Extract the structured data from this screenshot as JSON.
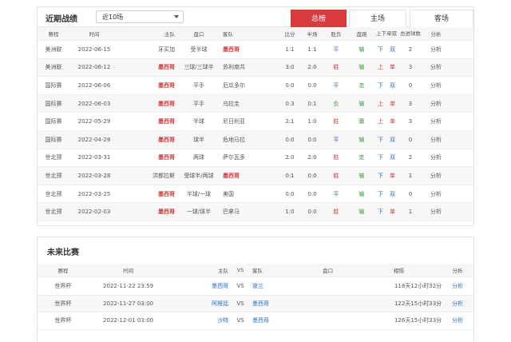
{
  "recent": {
    "title": "近期战绩",
    "select": {
      "value": "近10场"
    },
    "tabs": [
      {
        "label": "总榜",
        "active": true
      },
      {
        "label": "主场",
        "active": false
      },
      {
        "label": "客场",
        "active": false
      }
    ],
    "headers": [
      "赛程",
      "时间",
      "主队",
      "盘口",
      "客队",
      "比分",
      "半场",
      "胜负",
      "盘路",
      "上下单双",
      "总进球数",
      "分析"
    ],
    "rows": [
      {
        "league": "美洲联",
        "date": "2022-06-15",
        "home": "牙买加",
        "handicap": "受半球",
        "away": "墨西哥",
        "score": "1:1",
        "half": "1:1",
        "result": "平",
        "pan": "输",
        "ou": "下",
        "oe": "双",
        "goals": "2",
        "analysis": "分析"
      },
      {
        "league": "美洲联",
        "date": "2022-06-12",
        "home": "墨西哥",
        "handicap": "三球/三球半",
        "away": "苏利南共",
        "score": "3:0",
        "half": "2:0",
        "result": "胜",
        "pan": "输",
        "ou": "上",
        "oe": "单",
        "goals": "3",
        "analysis": "分析"
      },
      {
        "league": "国际赛",
        "date": "2022-06-06",
        "home": "墨西哥",
        "handicap": "平手",
        "away": "厄瓜多尔",
        "score": "0:0",
        "half": "0:0",
        "result": "平",
        "pan": "走",
        "ou": "下",
        "oe": "双",
        "goals": "0",
        "analysis": "分析"
      },
      {
        "league": "国际赛",
        "date": "2022-06-03",
        "home": "墨西哥",
        "handicap": "平手",
        "away": "乌拉圭",
        "score": "0:3",
        "half": "0:1",
        "result": "负",
        "pan": "输",
        "ou": "上",
        "oe": "单",
        "goals": "3",
        "analysis": "分析"
      },
      {
        "league": "国际赛",
        "date": "2022-05-29",
        "home": "墨西哥",
        "handicap": "半球",
        "away": "尼日利亚",
        "score": "2:1",
        "half": "1:0",
        "result": "胜",
        "pan": "赢",
        "ou": "上",
        "oe": "单",
        "goals": "3",
        "analysis": "分析"
      },
      {
        "league": "国际赛",
        "date": "2022-04-28",
        "home": "墨西哥",
        "handicap": "球半",
        "away": "危地马拉",
        "score": "0:0",
        "half": "0:0",
        "result": "平",
        "pan": "输",
        "ou": "下",
        "oe": "双",
        "goals": "0",
        "analysis": "分析"
      },
      {
        "league": "世北预",
        "date": "2022-03-31",
        "home": "墨西哥",
        "handicap": "两球",
        "away": "萨尔瓦多",
        "score": "2:0",
        "half": "2:0",
        "result": "胜",
        "pan": "走",
        "ou": "下",
        "oe": "双",
        "goals": "2",
        "analysis": "分析"
      },
      {
        "league": "世北预",
        "date": "2022-03-28",
        "home": "洪都拉斯",
        "handicap": "受球半/两球",
        "away": "墨西哥",
        "score": "0:1",
        "half": "0:0",
        "result": "胜",
        "pan": "输",
        "ou": "下",
        "oe": "单",
        "goals": "1",
        "analysis": "分析"
      },
      {
        "league": "世北预",
        "date": "2022-03-25",
        "home": "墨西哥",
        "handicap": "半球/一球",
        "away": "美国",
        "score": "0:0",
        "half": "0:0",
        "result": "平",
        "pan": "输",
        "ou": "下",
        "oe": "双",
        "goals": "0",
        "analysis": "分析"
      },
      {
        "league": "世北预",
        "date": "2022-02-03",
        "home": "墨西哥",
        "handicap": "一球/球半",
        "away": "巴拿马",
        "score": "1:0",
        "half": "0:0",
        "result": "胜",
        "pan": "输",
        "ou": "下",
        "oe": "单",
        "goals": "1",
        "analysis": "分析"
      }
    ]
  },
  "future": {
    "title": "未来比赛",
    "headers": [
      "赛程",
      "时间",
      "主队",
      "VS",
      "客队",
      "盘口",
      "相隔",
      "分析"
    ],
    "rows": [
      {
        "league": "世界杯",
        "time": "2022-11-22 23:59",
        "home": "墨西哥",
        "vs": "VS",
        "away": "波兰",
        "handicap": "",
        "gap": "118天12小时32分",
        "analysis": "分析"
      },
      {
        "league": "世界杯",
        "time": "2022-11-27 03:00",
        "home": "阿根廷",
        "vs": "VS",
        "away": "墨西哥",
        "handicap": "",
        "gap": "122天15小时33分",
        "analysis": "分析"
      },
      {
        "league": "世界杯",
        "time": "2022-12-01 03:00",
        "home": "沙特",
        "vs": "VS",
        "away": "墨西哥",
        "handicap": "",
        "gap": "126天15小时33分",
        "analysis": "分析"
      }
    ]
  },
  "colors": {
    "accent": "#d93a3e",
    "link": "#2b6fc2",
    "win": "#3a9a3a"
  }
}
